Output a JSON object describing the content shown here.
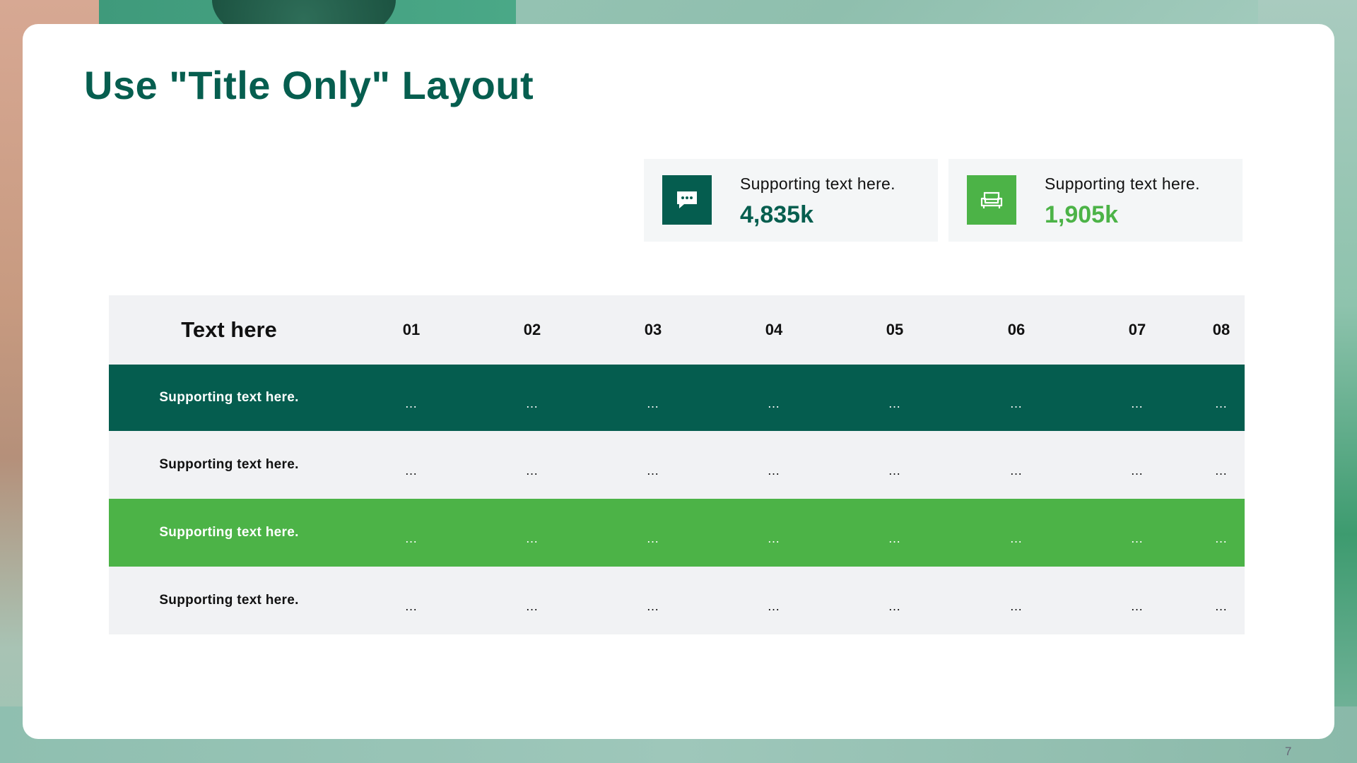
{
  "slide": {
    "title": "Use \"Title Only\" Layout",
    "page_number": "7"
  },
  "stats": [
    {
      "icon": "chat-bubble-icon",
      "label": "Supporting text here.",
      "value": "4,835k",
      "color": "#055d4f"
    },
    {
      "icon": "sofa-icon",
      "label": "Supporting text here.",
      "value": "1,905k",
      "color": "#4cb347"
    }
  ],
  "table": {
    "header_label": "Text here",
    "columns": [
      "01",
      "02",
      "03",
      "04",
      "05",
      "06",
      "07",
      "08"
    ],
    "rows": [
      {
        "label": "Supporting text here.",
        "cells": [
          "…",
          "…",
          "…",
          "…",
          "…",
          "…",
          "…",
          "…"
        ],
        "style": "dark"
      },
      {
        "label": "Supporting text here.",
        "cells": [
          "…",
          "…",
          "…",
          "…",
          "…",
          "…",
          "…",
          "…"
        ],
        "style": "light"
      },
      {
        "label": "Supporting text here.",
        "cells": [
          "…",
          "…",
          "…",
          "…",
          "…",
          "…",
          "…",
          "…"
        ],
        "style": "green"
      },
      {
        "label": "Supporting text here.",
        "cells": [
          "…",
          "…",
          "…",
          "…",
          "…",
          "…",
          "…",
          "…"
        ],
        "style": "light"
      }
    ]
  },
  "colors": {
    "dark_green": "#055d4f",
    "bright_green": "#4cb347",
    "light_gray": "#f1f2f4"
  }
}
